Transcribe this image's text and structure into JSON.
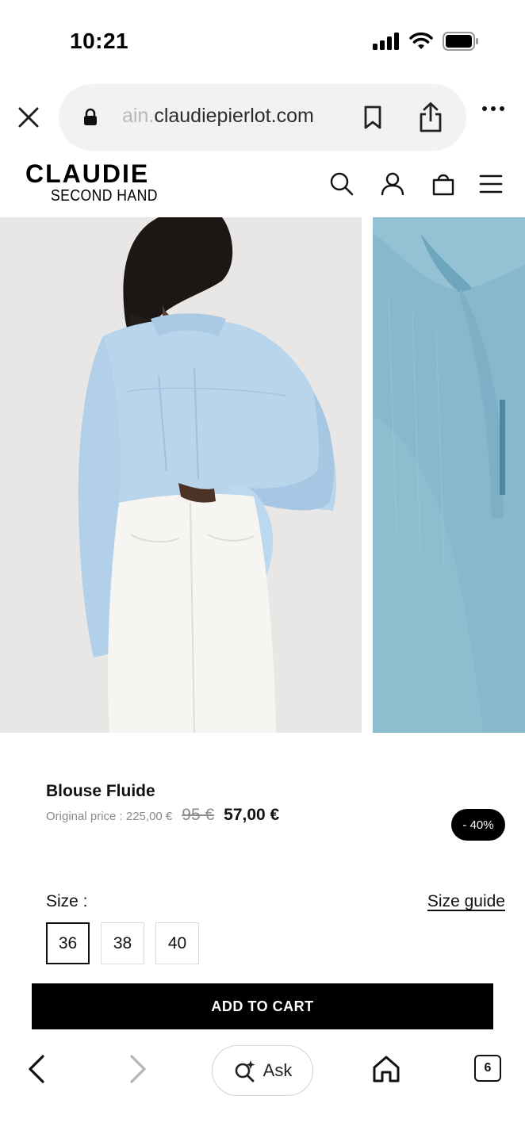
{
  "status_bar": {
    "time": "10:21"
  },
  "browser": {
    "url_faded_prefix": "ain.",
    "url_domain": "claudiepierlot.com",
    "tab_count": "6",
    "ask_label": "Ask"
  },
  "site": {
    "logo_main": "CLAUDIE",
    "logo_sub": "SECOND HAND"
  },
  "product": {
    "title": "Blouse Fluide",
    "original_price_label": "Original price : 225,00 €",
    "old_price": "95 €",
    "new_price": "57,00 €",
    "discount": "- 40%",
    "size_label": "Size :",
    "size_guide_label": "Size guide",
    "sizes": [
      "36",
      "38",
      "40"
    ],
    "selected_size": "36",
    "add_to_cart_label": "ADD TO CART"
  },
  "colors": {
    "accent": "#000000",
    "shirt_blue": "#b9d5ec",
    "detail_blue": "#87b8cc"
  },
  "icons": [
    "close-icon",
    "lock-icon",
    "bookmark-icon",
    "share-icon",
    "more-icon",
    "search-icon",
    "account-icon",
    "bag-icon",
    "menu-icon",
    "back-icon",
    "forward-icon",
    "ask-sparkle-icon",
    "home-icon",
    "tabs-icon"
  ]
}
